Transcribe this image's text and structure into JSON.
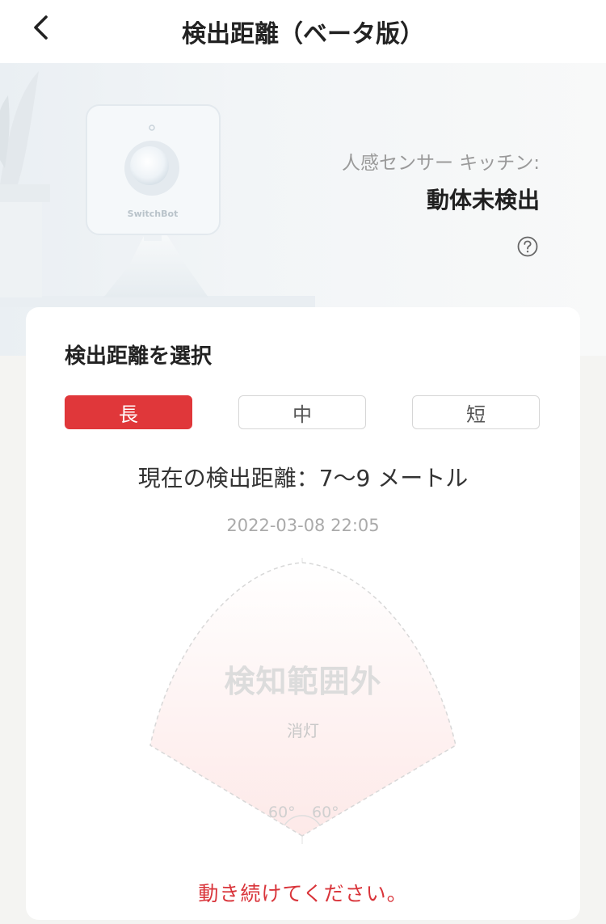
{
  "header": {
    "title": "検出距離（ベータ版）",
    "back_icon": "chevron-left-icon"
  },
  "hero": {
    "sensor_name": "人感センサー キッチン:",
    "status": "動体未検出",
    "help_icon": "question-circle-icon",
    "device_label": "SwitchBot"
  },
  "card": {
    "title": "検出距離を選択",
    "range_options": [
      {
        "label": "長",
        "selected": true
      },
      {
        "label": "中",
        "selected": false
      },
      {
        "label": "短",
        "selected": false
      }
    ],
    "current_distance": "現在の検出距離：7〜9 メートル",
    "timestamp": "2022-03-08 22:05",
    "radar": {
      "state": "検知範囲外",
      "light": "消灯",
      "angle_left": "60°",
      "angle_right": "60°"
    },
    "instruction": "動き続けてください。"
  },
  "colors": {
    "accent": "#e0373a",
    "instruction": "#d9343a"
  }
}
